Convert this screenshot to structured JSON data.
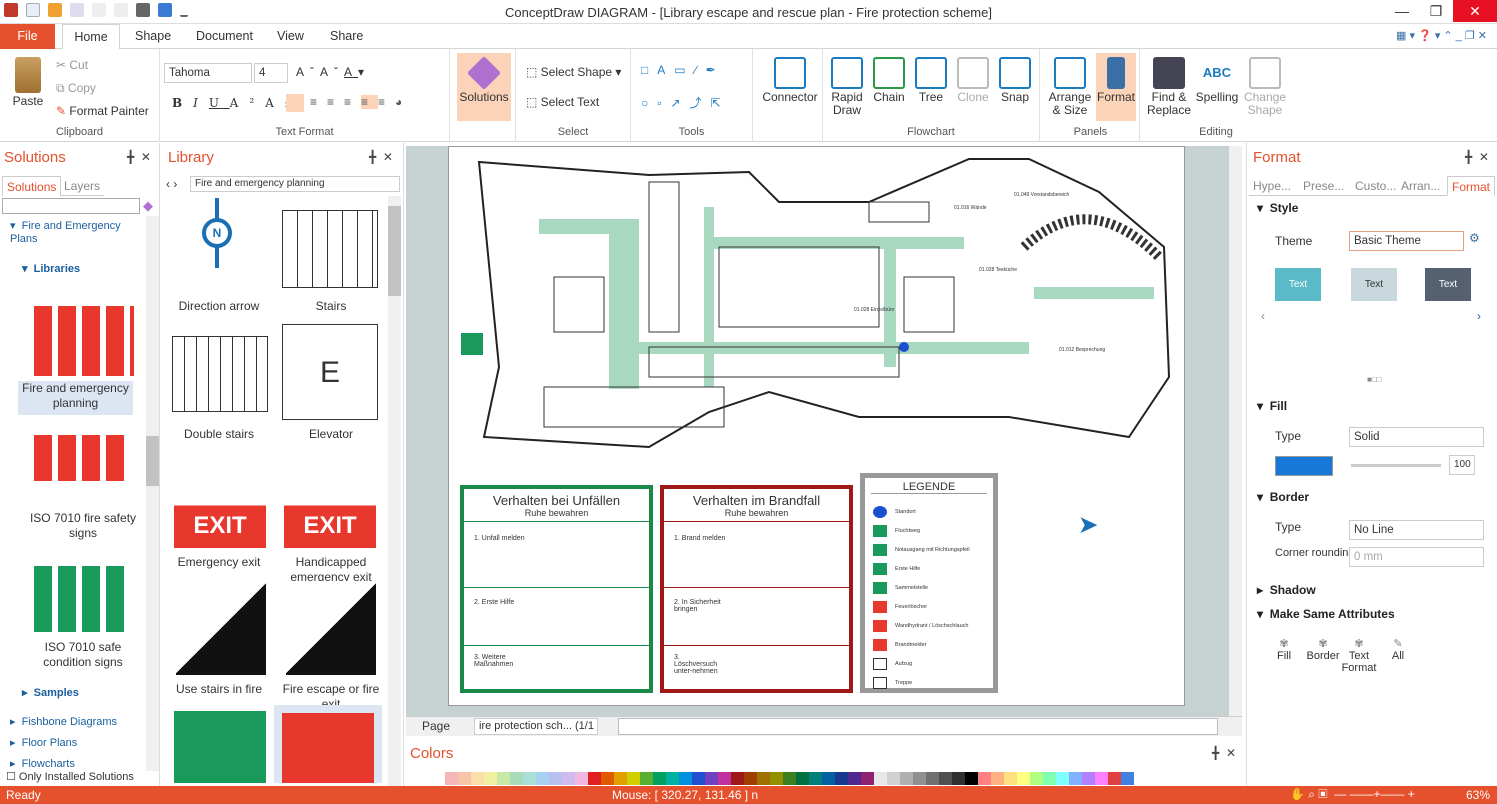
{
  "app": {
    "title": "ConceptDraw DIAGRAM - [Library escape and rescue plan - Fire protection scheme]"
  },
  "tabs": [
    "File",
    "Home",
    "Shape",
    "Document",
    "View",
    "Share"
  ],
  "ribbon": {
    "clipboard": {
      "label": "Clipboard",
      "paste": "Paste",
      "cut": "Cut",
      "copy": "Copy",
      "format_painter": "Format Painter"
    },
    "text_format": {
      "label": "Text Format",
      "font": "Tahoma",
      "size": "4"
    },
    "solutions": "Solutions",
    "select": {
      "label": "Select",
      "select_shape": "Select Shape",
      "select_text": "Select Text"
    },
    "tools": {
      "label": "Tools"
    },
    "connector": "Connector",
    "flowchart": {
      "label": "Flowchart",
      "rapid_draw": "Rapid Draw",
      "chain": "Chain",
      "tree": "Tree",
      "clone": "Clone",
      "snap": "Snap"
    },
    "panels": {
      "label": "Panels",
      "arrange": "Arrange & Size",
      "format": "Format"
    },
    "editing": {
      "label": "Editing",
      "find": "Find & Replace",
      "spelling": "Spelling",
      "change_shape": "Change Shape"
    }
  },
  "solutions_panel": {
    "title": "Solutions",
    "tabs": [
      "Solutions",
      "Layers"
    ],
    "tree": {
      "fire_emergency": "Fire and Emergency Plans",
      "libraries": "Libraries",
      "lib_items": [
        "Fire and emergency planning",
        "ISO 7010 fire safety signs",
        "ISO 7010 safe condition signs"
      ],
      "samples": "Samples",
      "others": [
        "Fishbone Diagrams",
        "Floor Plans",
        "Flowcharts"
      ]
    },
    "only_installed": "Only Installed Solutions"
  },
  "library_panel": {
    "title": "Library",
    "selector": "Fire and emergency planning",
    "items": [
      "Direction arrow",
      "Stairs",
      "Double stairs",
      "Elevator",
      "Emergency exit",
      "Handicapped emergency exit",
      "Use stairs in fire",
      "Fire escape or fire exit"
    ]
  },
  "canvas": {
    "box1_title": "Verhalten bei Unfällen",
    "box1_sub": "Ruhe bewahren",
    "box1_steps": [
      "Unfall melden",
      "Erste Hilfe",
      "Weitere Maßnahmen"
    ],
    "box2_title": "Verhalten im Brandfall",
    "box2_sub": "Ruhe bewahren",
    "box2_steps": [
      "Brand melden",
      "In Sicherheit bringen",
      "Löschversuch unter-nehmen"
    ],
    "legend_title": "LEGENDE",
    "legend_items": [
      "Standort",
      "Fluchtweg",
      "Notausgang mit Richtungspfeil",
      "Erste Hilfe",
      "Sammelstelle",
      "Feuerlöscher",
      "Wandhydrant / Löschschlauch",
      "Brandmelder",
      "Aufzug",
      "Treppe"
    ],
    "room_labels": [
      "01.016 Wände",
      "01.028 Teeküche",
      "01.028 Einzelbüro",
      "01.049 Vorstandsbereich",
      "01.012 Besprechung"
    ]
  },
  "page_bar": {
    "label": "Page",
    "page_name": "ire protection sch... (1/1"
  },
  "colors_panel": {
    "title": "Colors",
    "swatches": [
      "#ffffff",
      "#f4b6b6",
      "#f7c4a8",
      "#f9e0a8",
      "#f0f0a0",
      "#c8e8a8",
      "#a8dcb8",
      "#a8e0d8",
      "#a8d0f0",
      "#b8c0f0",
      "#d0b8f0",
      "#f0b8e0",
      "#e02020",
      "#e05a00",
      "#e0a000",
      "#d0d000",
      "#58b030",
      "#00a060",
      "#00b0a0",
      "#0090e0",
      "#2050d0",
      "#7040c0",
      "#c030a0",
      "#a01818",
      "#a04000",
      "#a07000",
      "#909000",
      "#3d8020",
      "#007040",
      "#008078",
      "#0060a0",
      "#183890",
      "#502890",
      "#902070",
      "#e8e8e8",
      "#d0d0d0",
      "#b0b0b0",
      "#909090",
      "#707070",
      "#505050",
      "#303030",
      "#000000",
      "#ff8080",
      "#ffb080",
      "#ffe080",
      "#ffff80",
      "#b0ff80",
      "#80ffb0",
      "#80ffff",
      "#80b0ff",
      "#b080ff",
      "#ff80ff",
      "#e04040",
      "#4080e0"
    ]
  },
  "format_panel": {
    "title": "Format",
    "tabs": [
      "Hype...",
      "Prese...",
      "Custo...",
      "Arran...",
      "Format"
    ],
    "style": "Style",
    "theme_label": "Theme",
    "theme_value": "Basic Theme",
    "theme_samples": [
      "Text",
      "Text",
      "Text"
    ],
    "fill": "Fill",
    "fill_type_label": "Type",
    "fill_type": "Solid",
    "fill_color": "#1878d8",
    "opacity": "100",
    "border": "Border",
    "border_type_label": "Type",
    "border_type": "No Line",
    "corner_label": "Corner rounding",
    "corner_value": "0 mm",
    "shadow": "Shadow",
    "make_same": "Make Same Attributes",
    "make_same_items": [
      "Fill",
      "Border",
      "Text Format",
      "All"
    ]
  },
  "status": {
    "left": "Ready",
    "mouse": "Mouse: [ 320.27, 131.46 ] n",
    "zoom": "63%"
  }
}
